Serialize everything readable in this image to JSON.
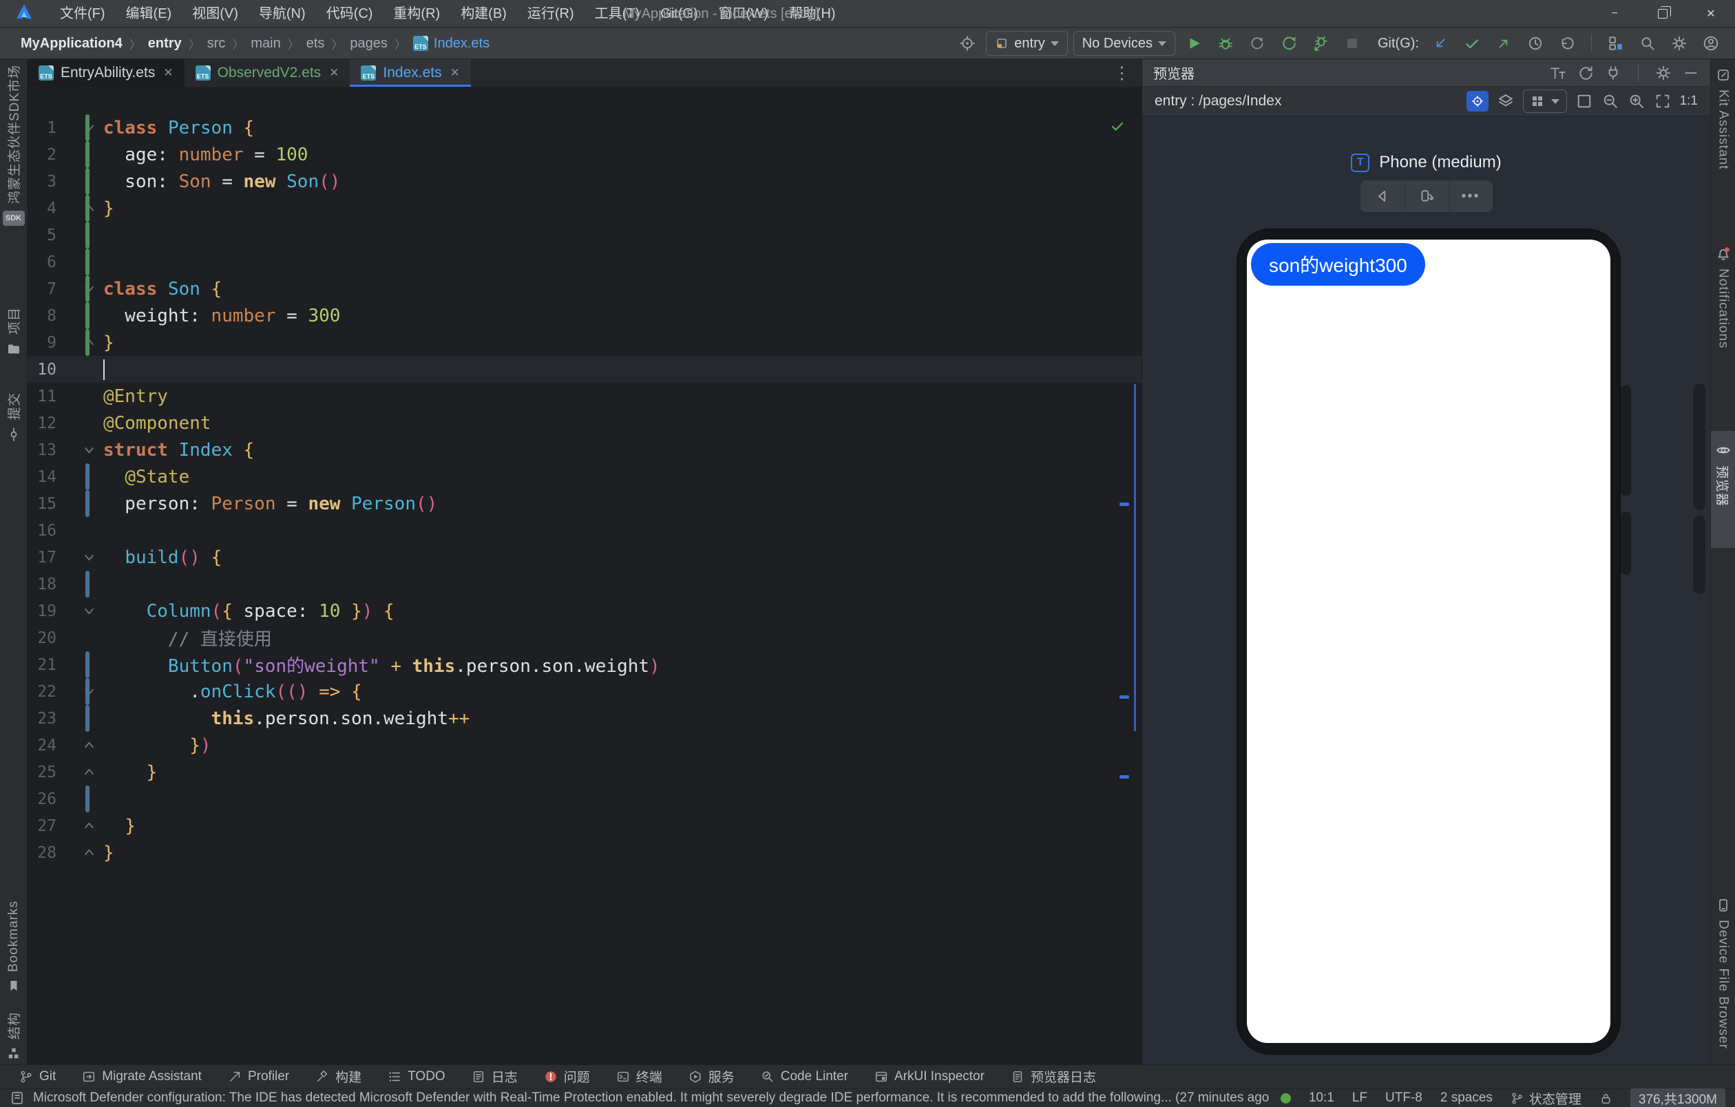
{
  "window": {
    "title": "MyApplication - Index.ets [entry]"
  },
  "ui": {
    "close": "✕",
    "kebab": "⋮",
    "more": "•••",
    "ets_badge": "ETS",
    "sdk_badge": "SDK",
    "minimize": "−"
  },
  "menu": {
    "items": [
      "文件(F)",
      "编辑(E)",
      "视图(V)",
      "导航(N)",
      "代码(C)",
      "重构(R)",
      "构建(B)",
      "运行(R)",
      "工具(T)",
      "Git(G)",
      "窗口(W)",
      "帮助(H)"
    ]
  },
  "breadcrumb": {
    "segments": [
      {
        "label": "MyApplication4",
        "bold": true
      },
      {
        "label": "entry",
        "bold": true
      },
      {
        "label": "src"
      },
      {
        "label": "main"
      },
      {
        "label": "ets"
      },
      {
        "label": "pages"
      },
      {
        "label": "Index.ets",
        "file": true
      }
    ]
  },
  "toolbar": {
    "run_config": "entry",
    "devices": "No Devices",
    "git_label": "Git(G):"
  },
  "tabs": [
    {
      "label": "EntryAbility.ets",
      "state": "plain"
    },
    {
      "label": "ObservedV2.ets",
      "state": "green"
    },
    {
      "label": "Index.ets",
      "state": "active"
    }
  ],
  "editor": {
    "caret_line": 10,
    "lines": [
      {
        "n": 1,
        "fold": "open",
        "bar": "green",
        "t": [
          [
            "kw",
            "class"
          ],
          [
            "pln",
            " "
          ],
          [
            "cyan",
            "Person"
          ],
          [
            "pln",
            " "
          ],
          [
            "br",
            "{"
          ]
        ]
      },
      {
        "n": 2,
        "bar": "green",
        "t": [
          [
            "pln",
            "  age"
          ],
          [
            "pln",
            ": "
          ],
          [
            "typ",
            "number"
          ],
          [
            "pln",
            " = "
          ],
          [
            "num",
            "100"
          ]
        ]
      },
      {
        "n": 3,
        "bar": "green",
        "t": [
          [
            "pln",
            "  son"
          ],
          [
            "pln",
            ": "
          ],
          [
            "typ",
            "Son"
          ],
          [
            "pln",
            " = "
          ],
          [
            "kwb",
            "new"
          ],
          [
            "pln",
            " "
          ],
          [
            "cyan",
            "Son"
          ],
          [
            "par",
            "()"
          ]
        ]
      },
      {
        "n": 4,
        "fold": "close",
        "bar": "green",
        "t": [
          [
            "br",
            "}"
          ]
        ]
      },
      {
        "n": 5,
        "bar": "green",
        "t": []
      },
      {
        "n": 6,
        "bar": "green",
        "t": []
      },
      {
        "n": 7,
        "fold": "open",
        "bar": "green",
        "t": [
          [
            "kw",
            "class"
          ],
          [
            "pln",
            " "
          ],
          [
            "cyan",
            "Son"
          ],
          [
            "pln",
            " "
          ],
          [
            "br",
            "{"
          ]
        ]
      },
      {
        "n": 8,
        "bar": "green",
        "t": [
          [
            "pln",
            "  weight"
          ],
          [
            "pln",
            ": "
          ],
          [
            "typ",
            "number"
          ],
          [
            "pln",
            " = "
          ],
          [
            "num",
            "300"
          ]
        ]
      },
      {
        "n": 9,
        "fold": "close",
        "bar": "green",
        "t": [
          [
            "br",
            "}"
          ]
        ]
      },
      {
        "n": 10,
        "current": true,
        "caret": true,
        "t": []
      },
      {
        "n": 11,
        "t": [
          [
            "ann",
            "@Entry"
          ]
        ]
      },
      {
        "n": 12,
        "t": [
          [
            "ann",
            "@Component"
          ]
        ]
      },
      {
        "n": 13,
        "fold": "open",
        "t": [
          [
            "kw",
            "struct"
          ],
          [
            "pln",
            " "
          ],
          [
            "cyan",
            "Index"
          ],
          [
            "pln",
            " "
          ],
          [
            "br",
            "{"
          ]
        ]
      },
      {
        "n": 14,
        "bar": "blue",
        "t": [
          [
            "pln",
            "  "
          ],
          [
            "ann",
            "@State"
          ]
        ]
      },
      {
        "n": 15,
        "bar": "blue",
        "t": [
          [
            "pln",
            "  person"
          ],
          [
            "pln",
            ": "
          ],
          [
            "typ",
            "Person"
          ],
          [
            "pln",
            " = "
          ],
          [
            "kwb",
            "new"
          ],
          [
            "pln",
            " "
          ],
          [
            "cyan",
            "Person"
          ],
          [
            "par",
            "()"
          ]
        ]
      },
      {
        "n": 16,
        "t": []
      },
      {
        "n": 17,
        "fold": "open",
        "t": [
          [
            "pln",
            "  "
          ],
          [
            "cyan",
            "build"
          ],
          [
            "par",
            "()"
          ],
          [
            "pln",
            " "
          ],
          [
            "br",
            "{"
          ]
        ]
      },
      {
        "n": 18,
        "bar": "blue",
        "t": []
      },
      {
        "n": 19,
        "fold": "open",
        "t": [
          [
            "pln",
            "    "
          ],
          [
            "cyan",
            "Column"
          ],
          [
            "par",
            "("
          ],
          [
            "br",
            "{"
          ],
          [
            "pln",
            " space"
          ],
          [
            "pln",
            ": "
          ],
          [
            "num",
            "10"
          ],
          [
            "pln",
            " "
          ],
          [
            "br",
            "}"
          ],
          [
            "par",
            ")"
          ],
          [
            "pln",
            " "
          ],
          [
            "br",
            "{"
          ]
        ]
      },
      {
        "n": 20,
        "t": [
          [
            "pln",
            "      "
          ],
          [
            "cmt",
            "// 直接使用"
          ]
        ]
      },
      {
        "n": 21,
        "bar": "blue",
        "t": [
          [
            "pln",
            "      "
          ],
          [
            "cyan",
            "Button"
          ],
          [
            "par",
            "("
          ],
          [
            "str",
            "\"son的weight\""
          ],
          [
            "pln",
            " "
          ],
          [
            "br",
            "+"
          ],
          [
            "pln",
            " "
          ],
          [
            "kwb",
            "this"
          ],
          [
            "pln",
            ".person.son.weight"
          ],
          [
            "par",
            ")"
          ]
        ]
      },
      {
        "n": 22,
        "fold": "open",
        "bar": "blue",
        "t": [
          [
            "pln",
            "        ."
          ],
          [
            "cyan",
            "onClick"
          ],
          [
            "par",
            "(()"
          ],
          [
            "pln",
            " "
          ],
          [
            "br",
            "=>"
          ],
          [
            "pln",
            " "
          ],
          [
            "br",
            "{"
          ]
        ]
      },
      {
        "n": 23,
        "bar": "blue",
        "t": [
          [
            "pln",
            "          "
          ],
          [
            "kwb",
            "this"
          ],
          [
            "pln",
            ".person.son.weight"
          ],
          [
            "br",
            "++"
          ]
        ]
      },
      {
        "n": 24,
        "fold": "close",
        "t": [
          [
            "pln",
            "        "
          ],
          [
            "br",
            "}"
          ],
          [
            "par",
            ")"
          ]
        ]
      },
      {
        "n": 25,
        "fold": "close",
        "t": [
          [
            "pln",
            "    "
          ],
          [
            "br",
            "}"
          ]
        ]
      },
      {
        "n": 26,
        "bar": "blue",
        "t": []
      },
      {
        "n": 27,
        "fold": "close",
        "t": [
          [
            "pln",
            "  "
          ],
          [
            "br",
            "}"
          ]
        ]
      },
      {
        "n": 28,
        "fold": "close",
        "t": [
          [
            "br",
            "}"
          ]
        ]
      }
    ]
  },
  "right_panel": {
    "title": "预览器",
    "path": "entry : /pages/Index",
    "zoom_label": "1:1",
    "device_label": "Phone (medium)",
    "preview_button": "son的weight300",
    "button_color": "#0a59f7"
  },
  "left_stripe": {
    "items": [
      {
        "label": "鸿蒙生态伙伴SDK市场"
      },
      {
        "label": "项目"
      },
      {
        "label": "提交"
      },
      {
        "label": "Bookmarks"
      },
      {
        "label": "结构"
      }
    ]
  },
  "right_stripe": {
    "items": [
      {
        "label": "Kit Assistant"
      },
      {
        "label": "Notifications"
      },
      {
        "label": "预览器",
        "active": true
      },
      {
        "label": "Device File Browser"
      }
    ]
  },
  "bottom_bar": {
    "items": [
      {
        "icon": "git-branch",
        "label": "Git"
      },
      {
        "icon": "migrate",
        "label": "Migrate Assistant"
      },
      {
        "icon": "profiler",
        "label": "Profiler"
      },
      {
        "icon": "build",
        "label": "构建"
      },
      {
        "icon": "todo",
        "label": "TODO"
      },
      {
        "icon": "log",
        "label": "日志"
      },
      {
        "icon": "error",
        "label": "问题"
      },
      {
        "icon": "terminal",
        "label": "终端"
      },
      {
        "icon": "services",
        "label": "服务"
      },
      {
        "icon": "lint",
        "label": "Code Linter"
      },
      {
        "icon": "inspector",
        "label": "ArkUI Inspector"
      },
      {
        "icon": "doc",
        "label": "预览器日志"
      }
    ]
  },
  "status_bar": {
    "message": "Microsoft Defender configuration: The IDE has detected Microsoft Defender with Real-Time Protection enabled. It might severely degrade IDE performance. It is recommended to add the following... (27 minutes ago",
    "position": "10:1",
    "line_ending": "LF",
    "encoding": "UTF-8",
    "indent": "2 spaces",
    "branch": "状态管理",
    "memory": "376,共1300M"
  }
}
